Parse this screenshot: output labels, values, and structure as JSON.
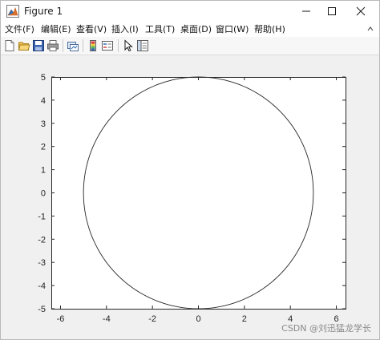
{
  "window": {
    "title": "Figure 1",
    "app_icon": "matlab-figure-icon"
  },
  "menu": {
    "items": [
      {
        "label": "文件(F)"
      },
      {
        "label": "编辑(E)"
      },
      {
        "label": "查看(V)"
      },
      {
        "label": "插入(I)"
      },
      {
        "label": "工具(T)"
      },
      {
        "label": "桌面(D)"
      },
      {
        "label": "窗口(W)"
      },
      {
        "label": "帮助(H)"
      }
    ]
  },
  "toolbar": {
    "icons": [
      "new-figure-icon",
      "open-file-icon",
      "save-icon",
      "print-icon",
      "link-plot-icon",
      "colorbar-icon",
      "legend-icon",
      "pointer-icon",
      "property-inspector-icon"
    ]
  },
  "chart_data": {
    "type": "line",
    "series": [
      {
        "shape": "circle",
        "center": [
          0,
          0
        ],
        "radius": 5,
        "color": "#262626"
      }
    ],
    "xlim": [
      -6.4,
      6.4
    ],
    "ylim": [
      -5,
      5
    ],
    "xticks": [
      -6,
      -4,
      -2,
      0,
      2,
      4,
      6
    ],
    "yticks": [
      -5,
      -4,
      -3,
      -2,
      -1,
      0,
      1,
      2,
      3,
      4,
      5
    ],
    "xtick_labels": [
      "-6",
      "-4",
      "-2",
      "0",
      "2",
      "4",
      "6"
    ],
    "ytick_labels": [
      "-5",
      "-4",
      "-3",
      "-2",
      "-1",
      "0",
      "1",
      "2",
      "3",
      "4",
      "5"
    ],
    "grid": false,
    "title": "",
    "xlabel": "",
    "ylabel": ""
  },
  "watermark": "CSDN @刘迅猛龙学长"
}
